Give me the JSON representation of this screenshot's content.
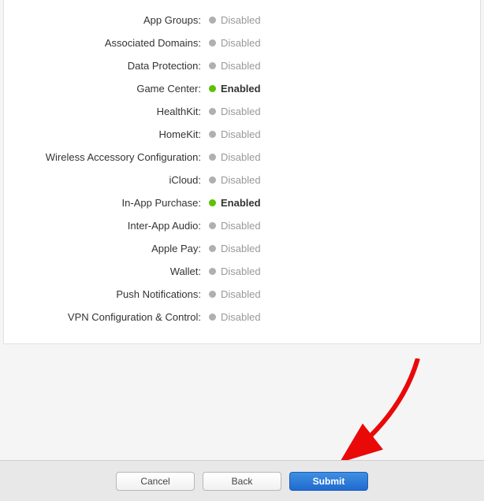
{
  "capabilities": [
    {
      "label": "App Groups:",
      "status": "Disabled",
      "enabled": false
    },
    {
      "label": "Associated Domains:",
      "status": "Disabled",
      "enabled": false
    },
    {
      "label": "Data Protection:",
      "status": "Disabled",
      "enabled": false
    },
    {
      "label": "Game Center:",
      "status": "Enabled",
      "enabled": true
    },
    {
      "label": "HealthKit:",
      "status": "Disabled",
      "enabled": false
    },
    {
      "label": "HomeKit:",
      "status": "Disabled",
      "enabled": false
    },
    {
      "label": "Wireless Accessory Configuration:",
      "status": "Disabled",
      "enabled": false
    },
    {
      "label": "iCloud:",
      "status": "Disabled",
      "enabled": false
    },
    {
      "label": "In-App Purchase:",
      "status": "Enabled",
      "enabled": true
    },
    {
      "label": "Inter-App Audio:",
      "status": "Disabled",
      "enabled": false
    },
    {
      "label": "Apple Pay:",
      "status": "Disabled",
      "enabled": false
    },
    {
      "label": "Wallet:",
      "status": "Disabled",
      "enabled": false
    },
    {
      "label": "Push Notifications:",
      "status": "Disabled",
      "enabled": false
    },
    {
      "label": "VPN Configuration & Control:",
      "status": "Disabled",
      "enabled": false
    }
  ],
  "buttons": {
    "cancel": "Cancel",
    "back": "Back",
    "submit": "Submit"
  },
  "colors": {
    "green": "#5cc100",
    "grey": "#b0b0b0",
    "primaryBlue": "#1f6bd0",
    "arrowRed": "#ea0909"
  }
}
